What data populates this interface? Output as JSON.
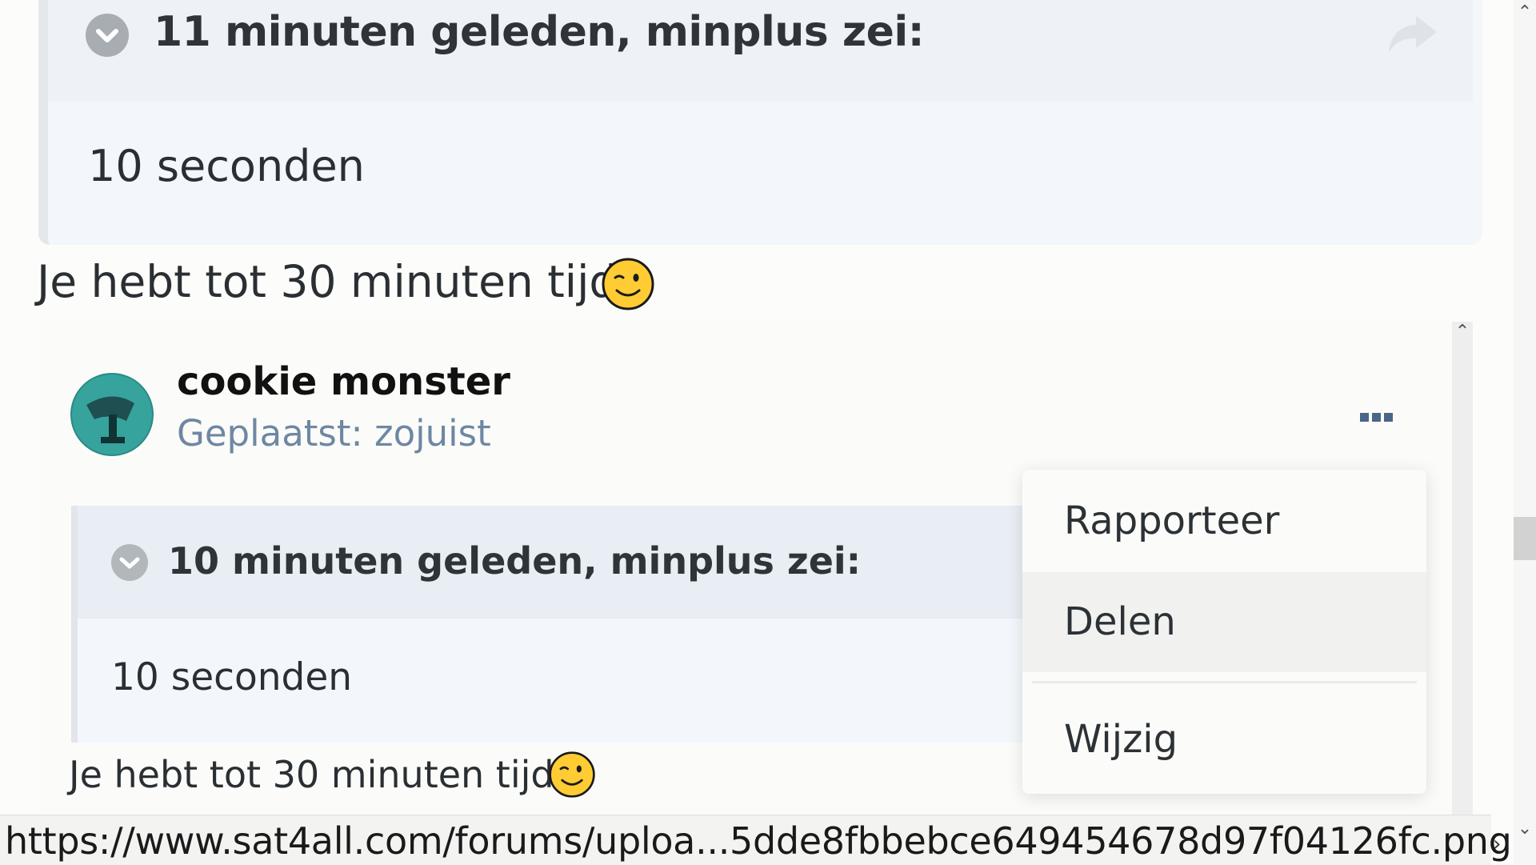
{
  "quote_top": {
    "title": "11 minuten geleden, minplus zei:",
    "body": "10 seconden"
  },
  "post_text_1": "Je hebt tot 30 minuten tijd",
  "embedded_post": {
    "author": "cookie monster",
    "posted": "Geplaatst: zojuist",
    "quote": {
      "title": "10 minuten geleden, minplus zei:",
      "body": "10 seconden"
    },
    "text": "Je hebt tot 30 minuten tijd"
  },
  "menu": {
    "items": [
      "Rapporteer",
      "Delen",
      "Wijzig"
    ]
  },
  "status_bar": {
    "url": "https://www.sat4all.com/forums/uploa...5dde8fbbebce649454678d97f04126fc.png"
  },
  "icons": {
    "collapse": "chevron-down-icon",
    "share": "share-arrow-icon",
    "more": "ellipsis-icon",
    "emoji": "wink-emoji-icon"
  }
}
